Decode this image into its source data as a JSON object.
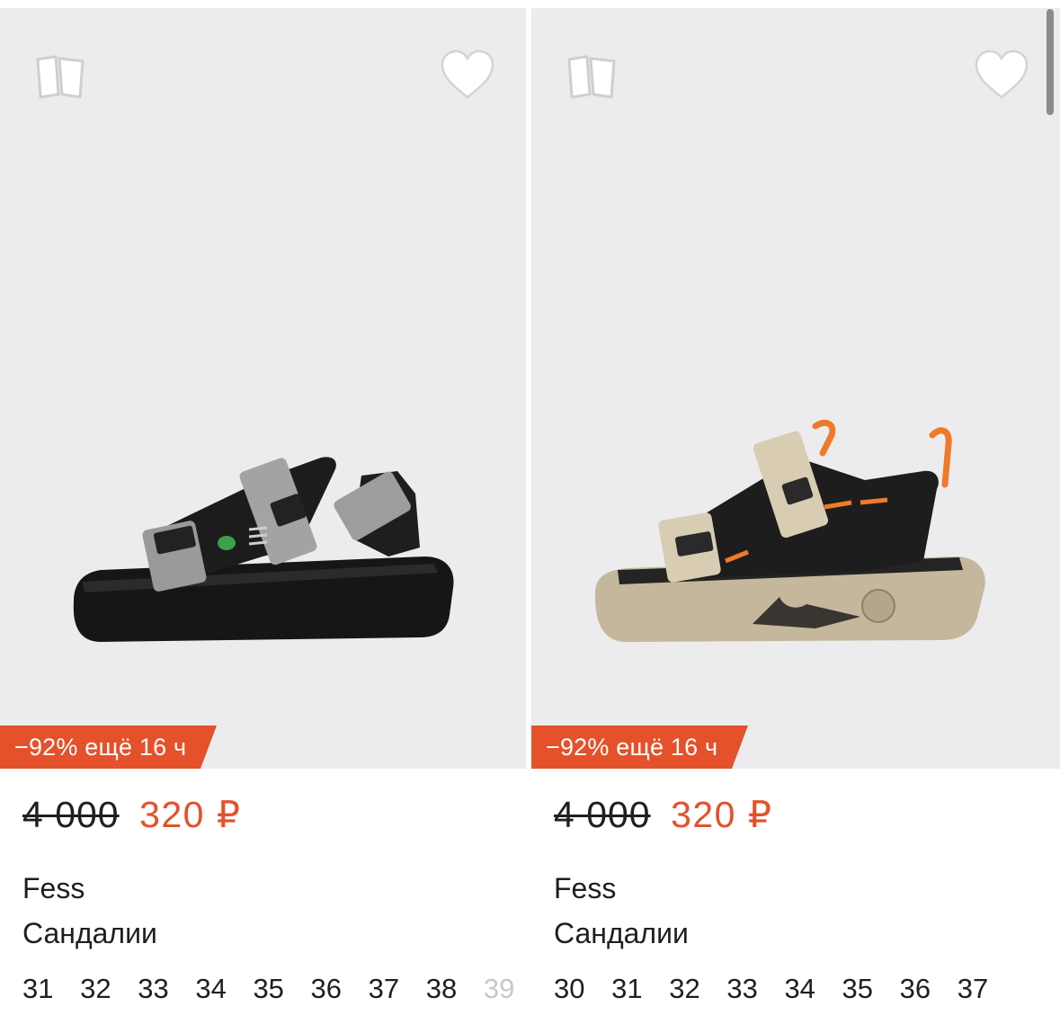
{
  "products": [
    {
      "discount_badge": "−92% ещё 16 ч",
      "old_price": "4 000",
      "new_price": "320 ₽",
      "brand": "Fess",
      "title": "Сандалии",
      "sizes": [
        "31",
        "32",
        "33",
        "34",
        "35",
        "36",
        "37",
        "38",
        "39"
      ],
      "colors": {
        "strap": "#9a9a9a",
        "sole": "#1a1a1a",
        "accent": "#3aa14a"
      }
    },
    {
      "discount_badge": "−92% ещё 16 ч",
      "old_price": "4 000",
      "new_price": "320 ₽",
      "brand": "Fess",
      "title": "Сандалии",
      "sizes": [
        "30",
        "31",
        "32",
        "33",
        "34",
        "35",
        "36",
        "37"
      ],
      "colors": {
        "strap": "#d8ccb2",
        "sole": "#c4b79b",
        "accent": "#f07a2a"
      }
    }
  ],
  "theme": {
    "accent": "#e4512a",
    "photo_bg": "#ececee",
    "text": "#1f1f1f"
  }
}
